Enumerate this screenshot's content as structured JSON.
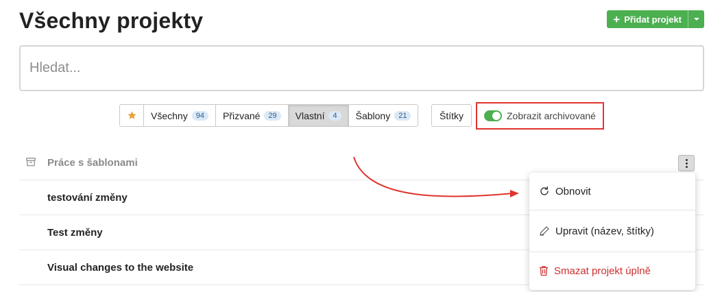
{
  "page": {
    "title": "Všechny projekty"
  },
  "header": {
    "add_project_label": "Přidat projekt"
  },
  "search": {
    "placeholder": "Hledat..."
  },
  "filters": {
    "tabs": [
      {
        "label": "Všechny",
        "count": "94"
      },
      {
        "label": "Přizvané",
        "count": "29"
      },
      {
        "label": "Vlastní",
        "count": "4"
      },
      {
        "label": "Šablony",
        "count": "21"
      }
    ],
    "active_tab": "Vlastní",
    "tags_label": "Štítky",
    "archive_toggle_label": "Zobrazit archivované",
    "archive_toggle_on": true
  },
  "projects": [
    {
      "name": "Práce s šablonami",
      "archived": true
    },
    {
      "name": "testování změny"
    },
    {
      "name": "Test změny"
    },
    {
      "name": "Visual changes to the website"
    }
  ],
  "context_menu": {
    "restore_label": "Obnovit",
    "edit_label": "Upravit (název, štítky)",
    "delete_label": "Smazat projekt úplně"
  },
  "colors": {
    "accent_green": "#4caf50",
    "highlight_red": "#e0332d",
    "danger_red": "#cf2e2e",
    "star": "#e8a13a"
  }
}
